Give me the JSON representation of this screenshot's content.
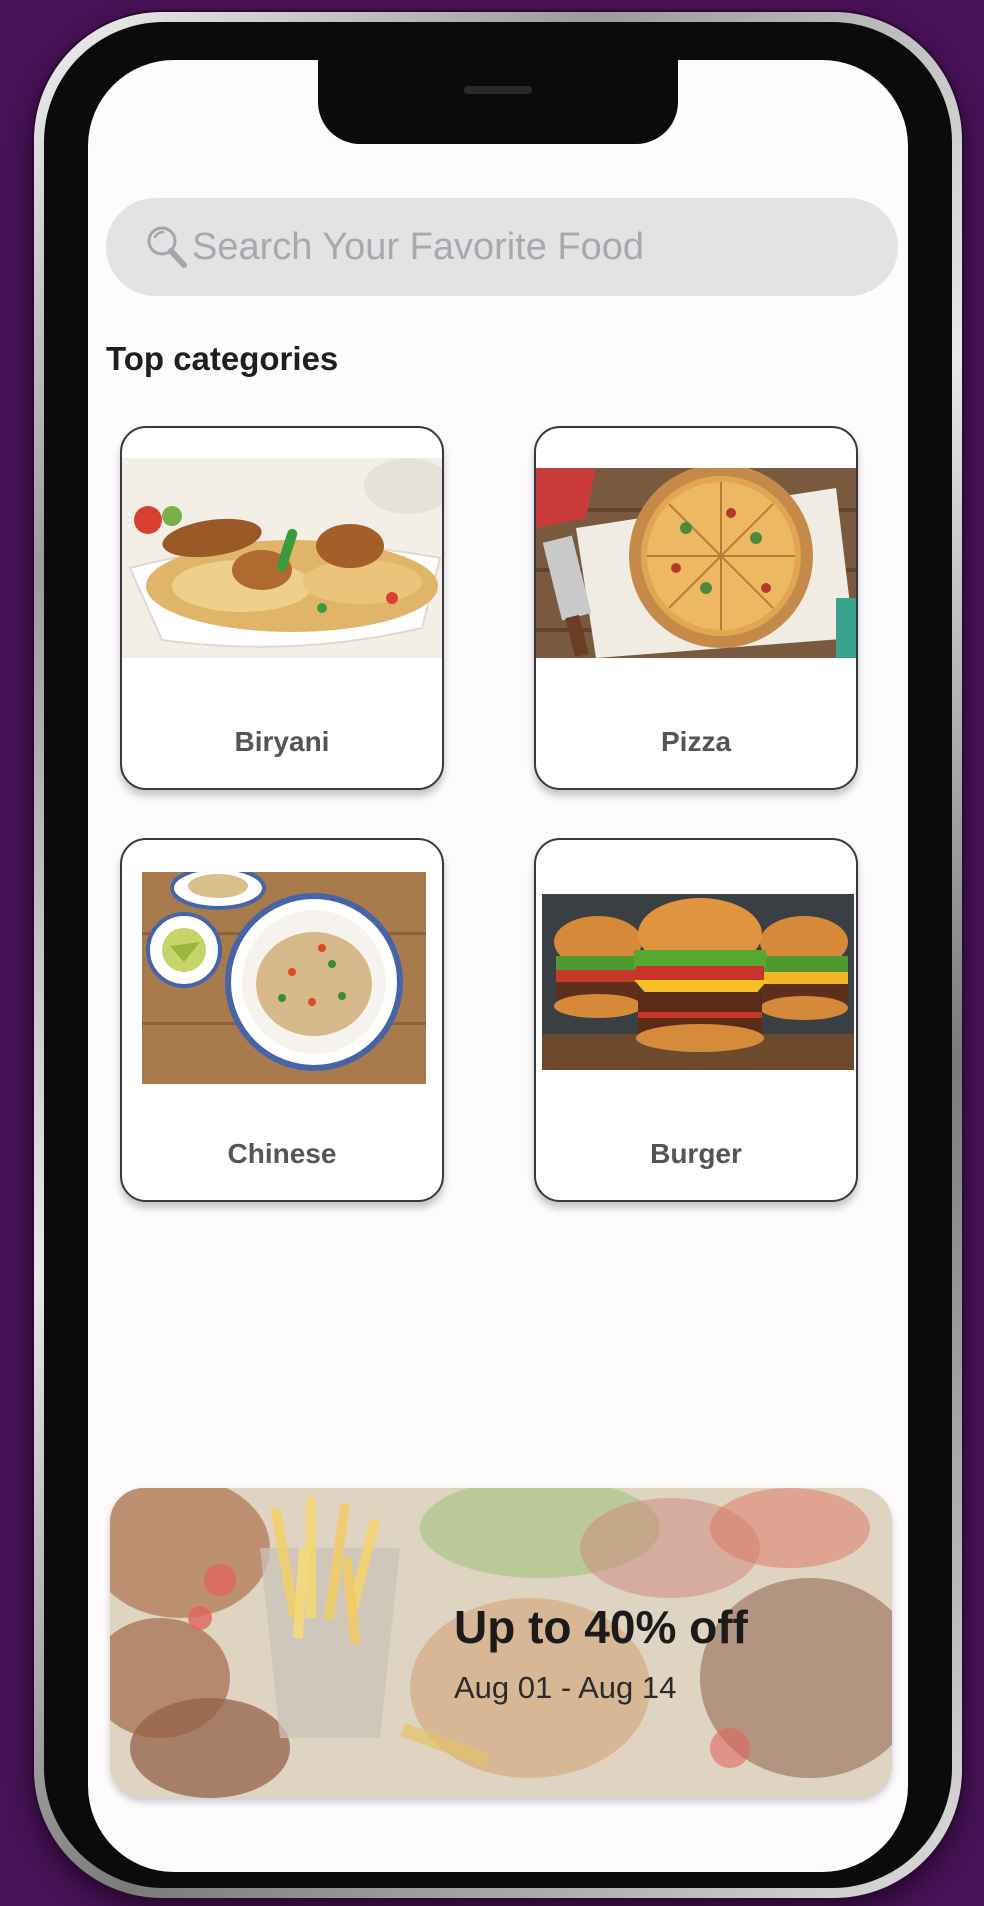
{
  "search": {
    "placeholder": "Search Your Favorite Food"
  },
  "categories": {
    "title": "Top categories",
    "items": [
      {
        "label": "Biryani"
      },
      {
        "label": "Pizza"
      },
      {
        "label": "Chinese"
      },
      {
        "label": "Burger"
      }
    ]
  },
  "promo": {
    "title": "Up to 40% off",
    "dates": "Aug 01 - Aug 14"
  },
  "colors": {
    "background": "#4a1259",
    "screen": "#fdfbfe",
    "search_bar": "#e3e3e5",
    "placeholder": "#a9a9ad",
    "card_border": "#3a3a3a",
    "card_label": "#555555"
  },
  "icons": {
    "search": "search-icon"
  }
}
